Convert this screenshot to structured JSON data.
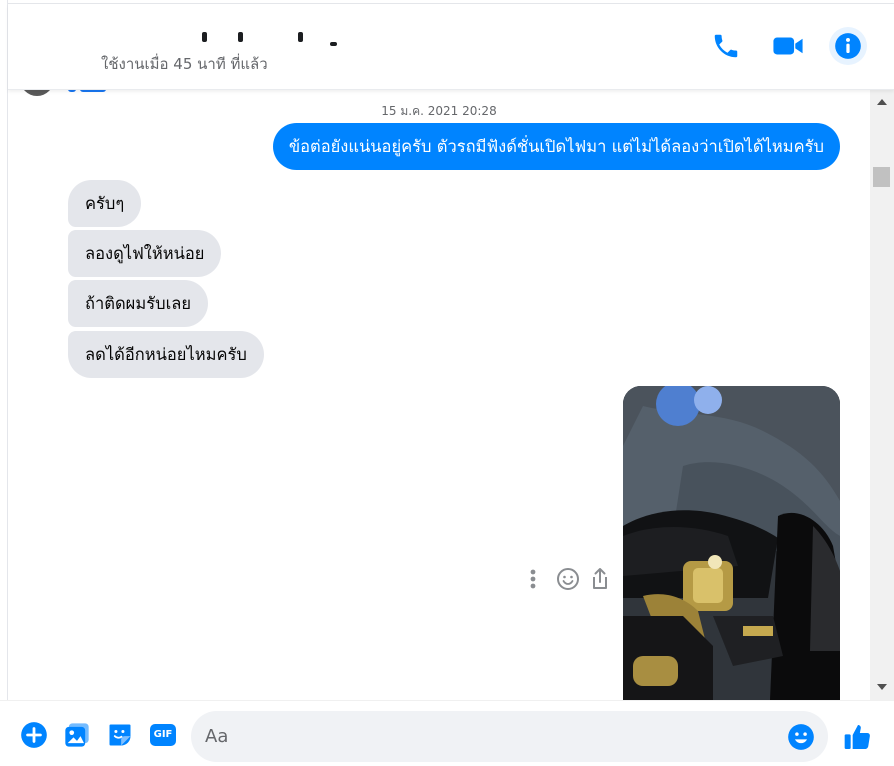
{
  "header": {
    "status": "ใช้งานเมื่อ 45 นาที ที่แล้ว",
    "icons": [
      "phone-icon",
      "video-camera-icon",
      "info-icon"
    ]
  },
  "conversation": {
    "timestamp": "15 ม.ค. 2021 20:28",
    "outgoing": [
      {
        "text": "ข้อต่อยังแน่นอยู่ครับ ตัวรถมีฟังด์ชั่นเปิดไฟมา แต่ไม่ได้ลองว่าเปิดได้ไหมครับ"
      }
    ],
    "incoming": [
      {
        "text": "ครับๆ"
      },
      {
        "text": "ลองดูไฟให้หน่อย"
      },
      {
        "text": "ถ้าติดผมรับเลย"
      },
      {
        "text": "ลดได้อีกหน่อยไหมครับ"
      }
    ],
    "message_actions": [
      "more-options-icon",
      "react-icon",
      "share-icon"
    ]
  },
  "composer": {
    "placeholder": "Aa",
    "icons": [
      "plus-icon",
      "photo-icon",
      "sticker-icon",
      "gif-icon",
      "emoji-icon",
      "thumbs-up-icon"
    ],
    "gif_label": "GIF"
  },
  "colors": {
    "accent": "#0084ff",
    "messenger_blue": "#1877f2",
    "incoming_bubble": "#e4e6eb",
    "composer_bg": "#f0f2f5"
  }
}
